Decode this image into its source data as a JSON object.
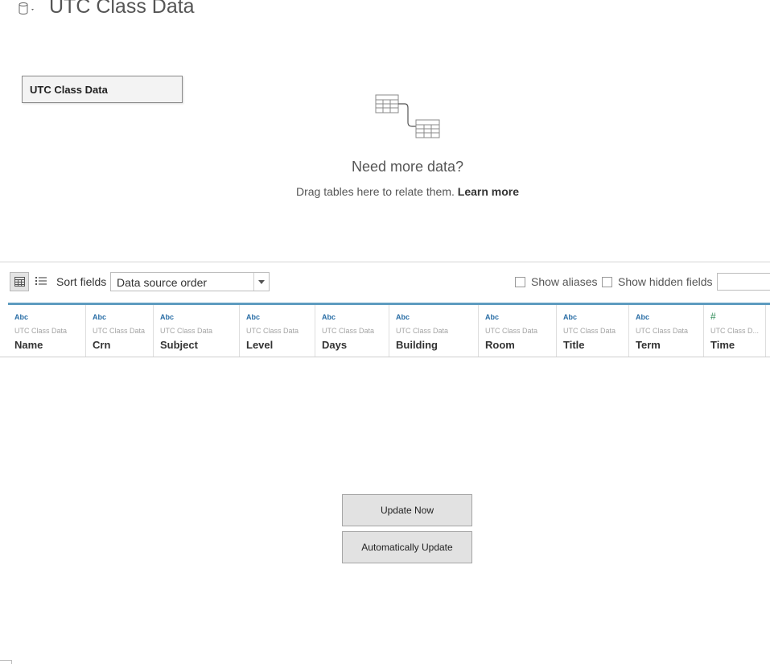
{
  "header": {
    "title": "UTC Class Data",
    "datasource_icon": "database-cylinder-icon"
  },
  "canvas": {
    "table_tile": "UTC Class Data",
    "relate_icon": "relate-tables-icon",
    "need_more": "Need more data?",
    "drag_hint": "Drag tables here to relate them.",
    "learn_more": "Learn more"
  },
  "toolbar": {
    "grid_view_icon": "grid-view-icon",
    "list_view_icon": "list-view-icon",
    "sort_label": "Sort fields",
    "sort_value": "Data source order",
    "show_aliases": "Show aliases",
    "show_hidden": "Show hidden fields"
  },
  "fields": [
    {
      "type": "Abc",
      "source": "UTC Class Data",
      "name": "Name"
    },
    {
      "type": "Abc",
      "source": "UTC Class Data",
      "name": "Crn"
    },
    {
      "type": "Abc",
      "source": "UTC Class Data",
      "name": "Subject"
    },
    {
      "type": "Abc",
      "source": "UTC Class Data",
      "name": "Level"
    },
    {
      "type": "Abc",
      "source": "UTC Class Data",
      "name": "Days"
    },
    {
      "type": "Abc",
      "source": "UTC Class Data",
      "name": "Building"
    },
    {
      "type": "Abc",
      "source": "UTC Class Data",
      "name": "Room"
    },
    {
      "type": "Abc",
      "source": "UTC Class Data",
      "name": "Title"
    },
    {
      "type": "Abc",
      "source": "UTC Class Data",
      "name": "Term"
    },
    {
      "type": "#",
      "source": "UTC Class D...",
      "name": "Time"
    }
  ],
  "update": {
    "update_now": "Update Now",
    "auto_update": "Automatically Update"
  },
  "colors": {
    "accent_line": "#5e9cc0",
    "string_type": "#2a6ea6",
    "number_type": "#2e8b57"
  }
}
